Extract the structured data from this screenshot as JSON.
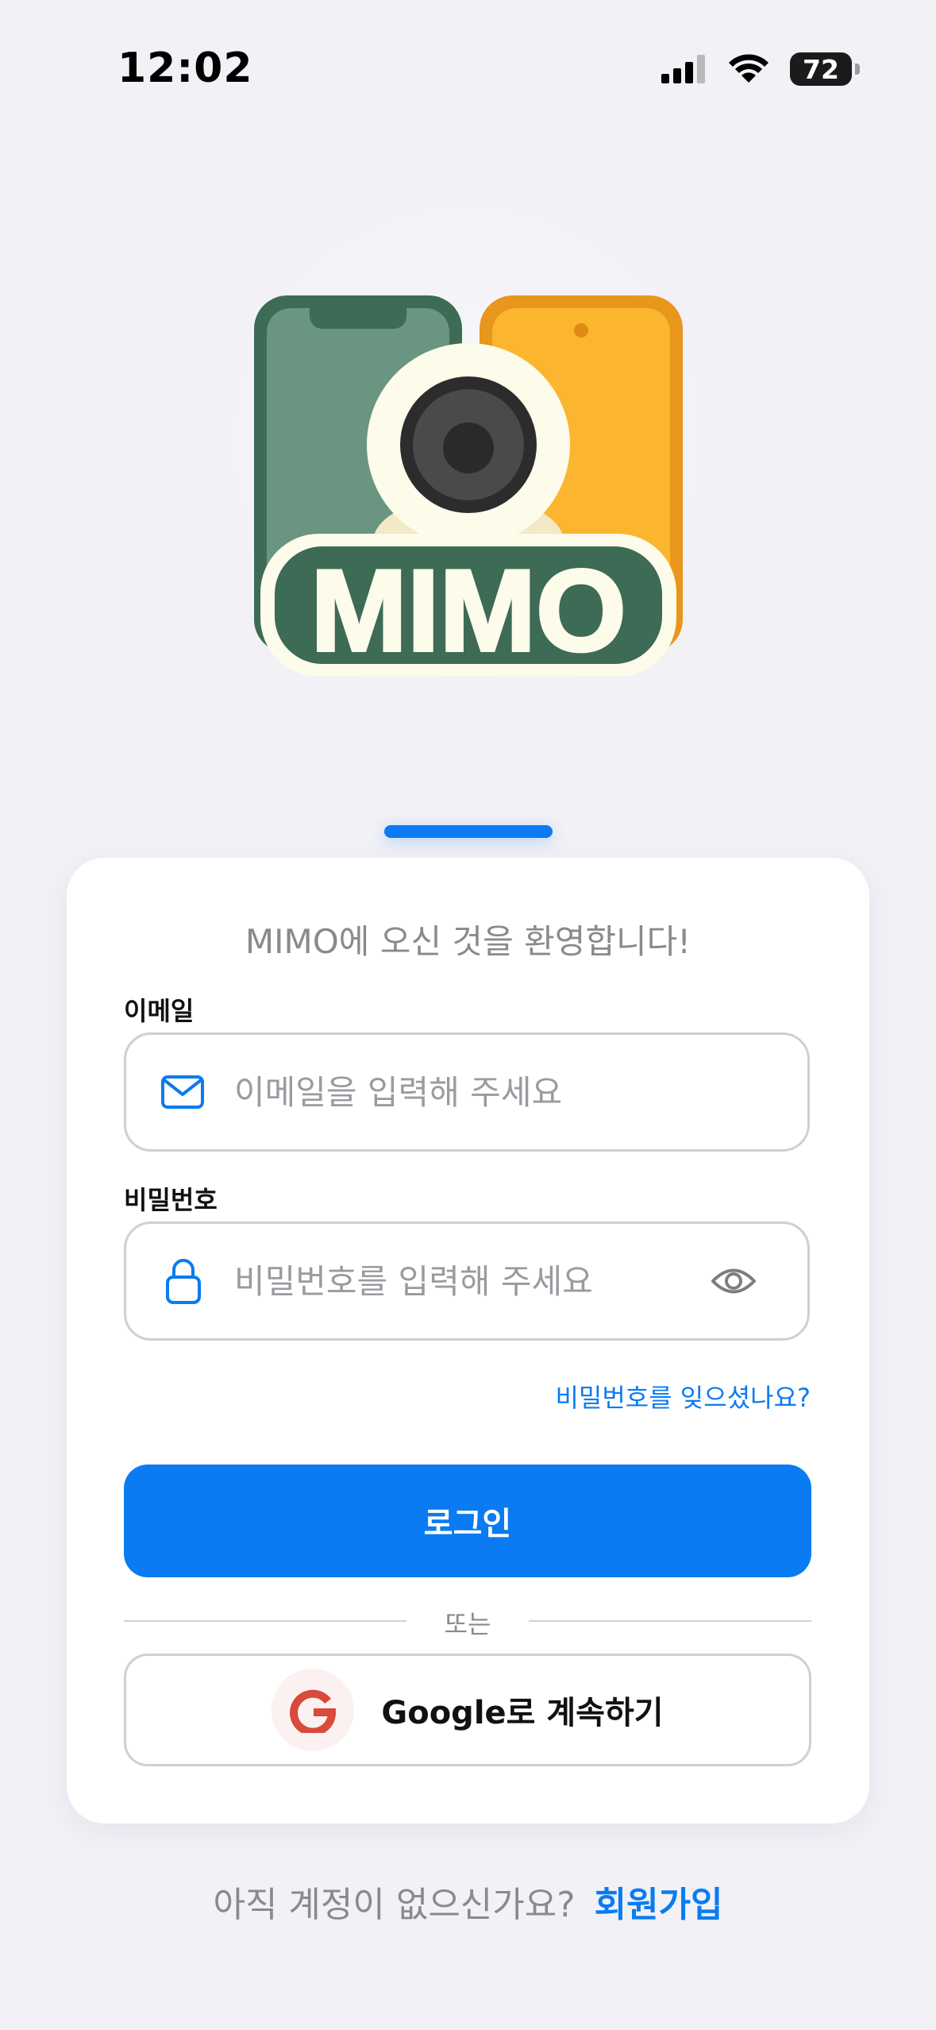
{
  "status_bar": {
    "time": "12:02",
    "battery": "72",
    "battery_level": 0.72
  },
  "logo": {
    "text": "MIMO",
    "icon": "mimo-camera-phones-logo"
  },
  "colors": {
    "accent": "#0a7bf2",
    "logo_green": "#3d6b55",
    "logo_yellow": "#fbb52f",
    "background": "#f1f1f6"
  },
  "card": {
    "welcome": "MIMO에 오신 것을 환영합니다!",
    "email": {
      "label": "이메일",
      "placeholder": "이메일을 입력해 주세요",
      "icon": "mail-icon"
    },
    "password": {
      "label": "비밀번호",
      "placeholder": "비밀번호를 입력해 주세요",
      "icon": "lock-icon",
      "toggle_icon": "eye-icon"
    },
    "forgot_password": "비밀번호를 잊으셨나요?",
    "login_button": "로그인",
    "divider": "또는",
    "google_button": "Google로 계속하기",
    "google_icon": "google-g-icon"
  },
  "signup": {
    "question": "아직 계정이 없으신가요?",
    "link": "회원가입"
  }
}
